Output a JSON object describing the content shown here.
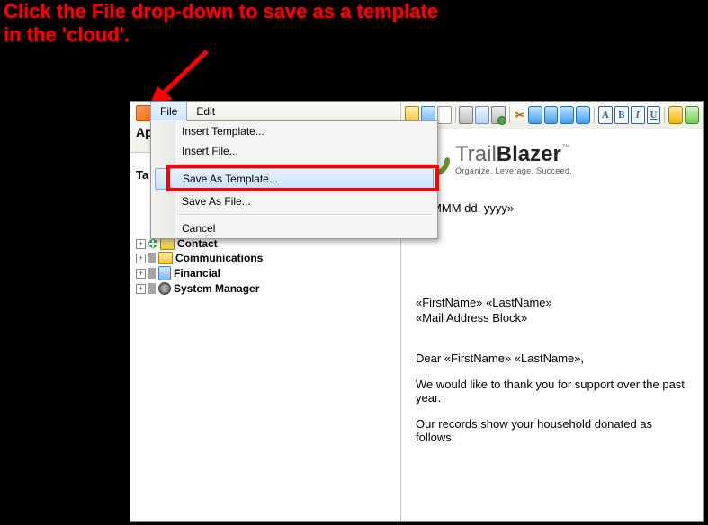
{
  "instruction": {
    "line1": "Click the File drop-down to save as a template",
    "line2": "in the 'cloud'."
  },
  "leftPanel": {
    "ap": "Ap",
    "ta": "Ta"
  },
  "menubar": {
    "file": "File",
    "edit": "Edit"
  },
  "fileMenu": {
    "insertTemplate": "Insert Template...",
    "insertFile": "Insert File...",
    "saveAsTemplate": "Save As Template...",
    "saveAsFile": "Save As File...",
    "cancel": "Cancel"
  },
  "tree": {
    "contact": "Contact",
    "communications": "Communications",
    "financial": "Financial",
    "systemManager": "System Manager"
  },
  "toolbarIcons": {
    "open": "open-icon",
    "save": "save-icon",
    "page": "page-icon",
    "print": "print-icon",
    "printPreview": "print-preview-icon",
    "printSetup": "print-setup-icon",
    "cut": "cut-icon",
    "copy": "copy-icon",
    "paste": "paste-icon",
    "undo": "undo-icon",
    "redo": "redo-icon",
    "fontA": "A",
    "bold": "B",
    "italic": "I",
    "underline": "U",
    "link": "link-icon",
    "table": "table-icon"
  },
  "logo": {
    "light": "Trail",
    "bold": "Blazer",
    "tm": "™",
    "tagline": "Organize. Leverage. Succeed."
  },
  "document": {
    "dateField": "«MMMM dd, yyyy»",
    "nameLine": "«FirstName» «LastName»",
    "addressBlock": "«Mail Address Block»",
    "salutation": "Dear «FirstName» «LastName»,",
    "body1": "We would like to thank you for support over the past year.",
    "body2": "Our records show your household donated as follows:"
  }
}
